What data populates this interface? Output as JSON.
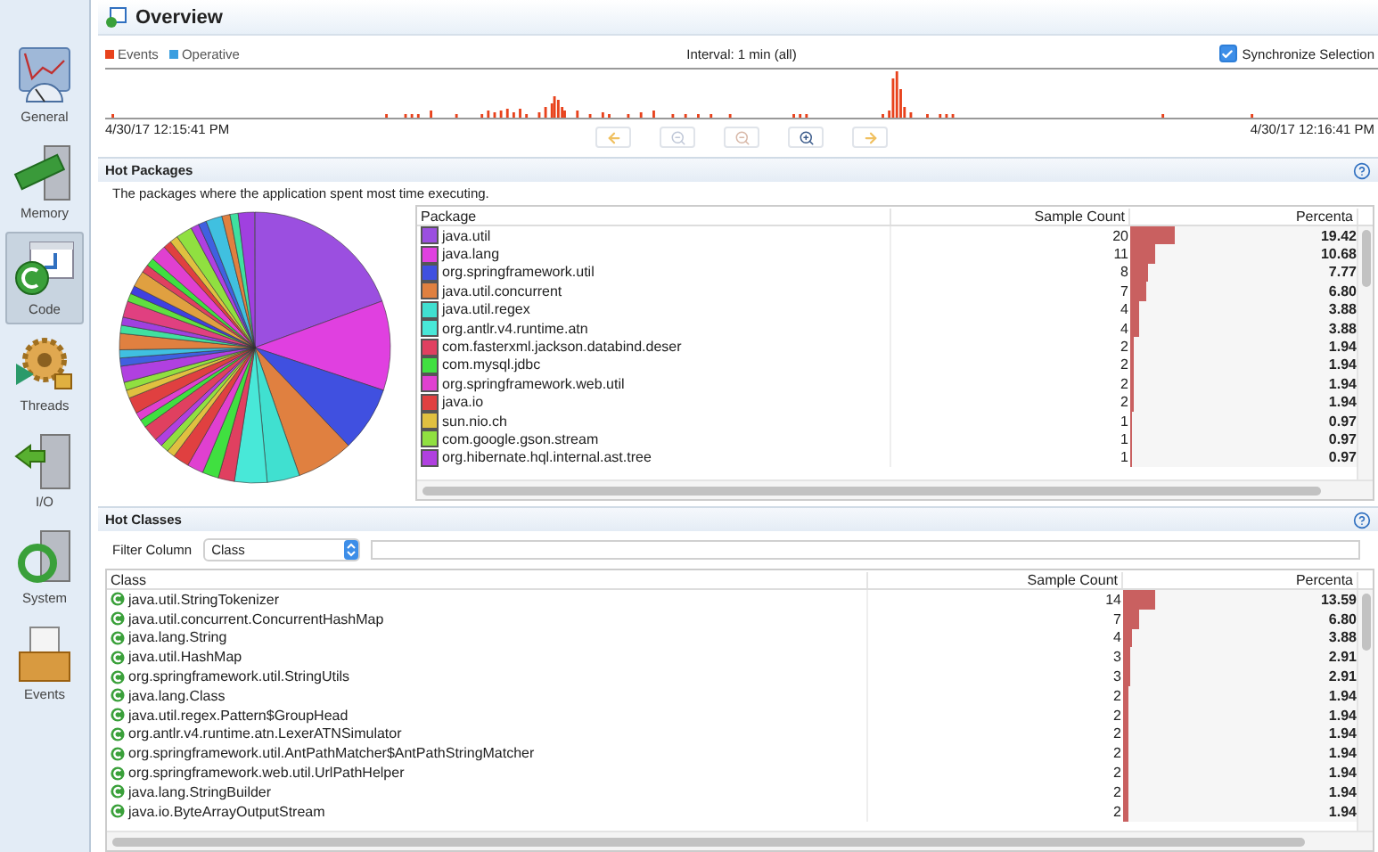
{
  "sidebar": {
    "items": [
      {
        "label": "General",
        "kind": "general",
        "selected": false
      },
      {
        "label": "Memory",
        "kind": "memory",
        "selected": false
      },
      {
        "label": "Code",
        "kind": "code",
        "selected": true
      },
      {
        "label": "Threads",
        "kind": "threads",
        "selected": false
      },
      {
        "label": "I/O",
        "kind": "io",
        "selected": false
      },
      {
        "label": "System",
        "kind": "system",
        "selected": false
      },
      {
        "label": "Events",
        "kind": "events",
        "selected": false
      }
    ]
  },
  "header": {
    "title": "Overview"
  },
  "timeline": {
    "legend": [
      {
        "label": "Events",
        "color": "#e8421c"
      },
      {
        "label": "Operative",
        "color": "#3a9ee0"
      }
    ],
    "interval": "Interval: 1 min (all)",
    "synchronize": {
      "label": "Synchronize Selection",
      "checked": true
    },
    "start_time": "4/30/17 12:15:41 PM",
    "end_time": "4/30/17 12:16:41 PM"
  },
  "hot_packages": {
    "title": "Hot Packages",
    "description": "The packages where the application spent most time executing.",
    "columns": [
      "Package",
      "Sample Count",
      "Percenta"
    ],
    "rows": [
      {
        "name": "java.util",
        "color": "#9b4fe0",
        "count": "20",
        "level": 0.1942,
        "percent": "19.42"
      },
      {
        "name": "java.lang",
        "color": "#e040e0",
        "count": "11",
        "level": 0.1068,
        "percent": "10.68"
      },
      {
        "name": "org.springframework.util",
        "color": "#4050e0",
        "count": "8",
        "level": 0.0777,
        "percent": "7.77"
      },
      {
        "name": "java.util.concurrent",
        "color": "#e08040",
        "count": "7",
        "level": 0.068,
        "percent": "6.80"
      },
      {
        "name": "java.util.regex",
        "color": "#40e0d0",
        "count": "4",
        "level": 0.0388,
        "percent": "3.88"
      },
      {
        "name": "org.antlr.v4.runtime.atn",
        "color": "#48e8d8",
        "count": "4",
        "level": 0.0388,
        "percent": "3.88"
      },
      {
        "name": "com.fasterxml.jackson.databind.deser",
        "color": "#e04060",
        "count": "2",
        "level": 0.0194,
        "percent": "1.94"
      },
      {
        "name": "com.mysql.jdbc",
        "color": "#40e040",
        "count": "2",
        "level": 0.0194,
        "percent": "1.94"
      },
      {
        "name": "org.springframework.web.util",
        "color": "#e040d0",
        "count": "2",
        "level": 0.0194,
        "percent": "1.94"
      },
      {
        "name": "java.io",
        "color": "#e04040",
        "count": "2",
        "level": 0.0194,
        "percent": "1.94"
      },
      {
        "name": "sun.nio.ch",
        "color": "#e0c040",
        "count": "1",
        "level": 0.0097,
        "percent": "0.97"
      },
      {
        "name": "com.google.gson.stream",
        "color": "#90e040",
        "count": "1",
        "level": 0.0097,
        "percent": "0.97"
      },
      {
        "name": "org.hibernate.hql.internal.ast.tree",
        "color": "#b040e0",
        "count": "1",
        "level": 0.0097,
        "percent": "0.97"
      }
    ]
  },
  "hot_classes": {
    "title": "Hot Classes",
    "filter": {
      "label": "Filter Column",
      "value": "Class"
    },
    "columns": [
      "Class",
      "Sample Count",
      "Percenta"
    ],
    "rows": [
      {
        "name": "java.util.StringTokenizer",
        "count": "14",
        "level": 0.1359,
        "percent": "13.59"
      },
      {
        "name": "java.util.concurrent.ConcurrentHashMap",
        "count": "7",
        "level": 0.068,
        "percent": "6.80"
      },
      {
        "name": "java.lang.String",
        "count": "4",
        "level": 0.0388,
        "percent": "3.88"
      },
      {
        "name": "java.util.HashMap",
        "count": "3",
        "level": 0.0291,
        "percent": "2.91"
      },
      {
        "name": "org.springframework.util.StringUtils",
        "count": "3",
        "level": 0.0291,
        "percent": "2.91"
      },
      {
        "name": "java.lang.Class",
        "count": "2",
        "level": 0.0194,
        "percent": "1.94"
      },
      {
        "name": "java.util.regex.Pattern$GroupHead",
        "count": "2",
        "level": 0.0194,
        "percent": "1.94"
      },
      {
        "name": "org.antlr.v4.runtime.atn.LexerATNSimulator",
        "count": "2",
        "level": 0.0194,
        "percent": "1.94"
      },
      {
        "name": "org.springframework.util.AntPathMatcher$AntPathStringMatcher",
        "count": "2",
        "level": 0.0194,
        "percent": "1.94"
      },
      {
        "name": "org.springframework.web.util.UrlPathHelper",
        "count": "2",
        "level": 0.0194,
        "percent": "1.94"
      },
      {
        "name": "java.lang.StringBuilder",
        "count": "2",
        "level": 0.0194,
        "percent": "1.94"
      },
      {
        "name": "java.io.ByteArrayOutputStream",
        "count": "2",
        "level": 0.0194,
        "percent": "1.94"
      }
    ]
  }
}
